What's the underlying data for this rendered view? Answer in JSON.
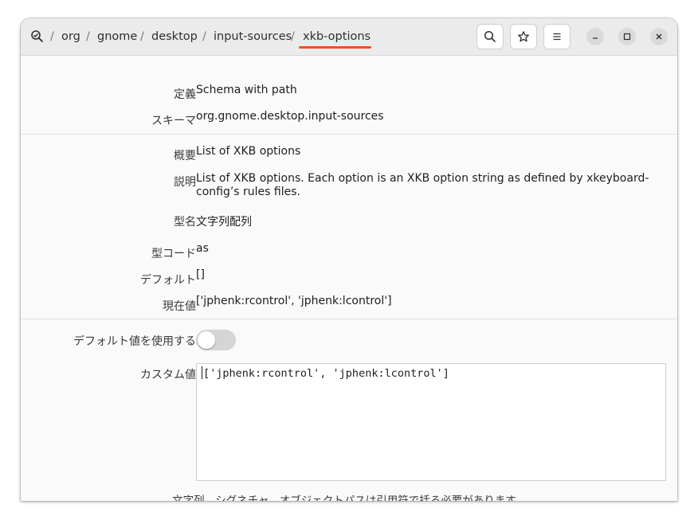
{
  "breadcrumb": {
    "items": [
      "org",
      "gnome",
      "desktop",
      "input-sources",
      "xkb-options"
    ],
    "separator": "/",
    "active_index": 4
  },
  "header_buttons": {
    "search": "search-icon",
    "bookmark": "star-icon",
    "menu": "hamburger-icon"
  },
  "window_controls": [
    "minimize",
    "maximize",
    "close"
  ],
  "schema_section": {
    "definition_label": "定義",
    "definition_value": "Schema with path",
    "schema_label": "スキーマ",
    "schema_value": "org.gnome.desktop.input-sources"
  },
  "key_section": {
    "summary_label": "概要",
    "summary_value": "List of XKB options",
    "description_label": "説明",
    "description_value": "List of XKB options. Each option is an XKB option string as defined by xkeyboard-config’s rules files.",
    "type_label": "型名",
    "type_value": "文字列配列",
    "type_code_label": "型コード",
    "type_code_value": "as",
    "default_label": "デフォルト",
    "default_value": "[]",
    "current_label": "現在値",
    "current_value": "['jphenk:rcontrol', 'jphenk:lcontrol']"
  },
  "edit_section": {
    "use_default_label": "デフォルト値を使用する",
    "use_default_on": false,
    "custom_label": "カスタム値",
    "custom_value": "['jphenk:rcontrol', 'jphenk:lcontrol']",
    "hint": "文字列、シグネチャ、オブジェクトパスは引用符で括る必要があります。"
  },
  "colors": {
    "accent": "#e95420",
    "header_bg": "#ebebeb",
    "content_bg": "#fafafa",
    "toggle_off": "#d5d5d5"
  }
}
